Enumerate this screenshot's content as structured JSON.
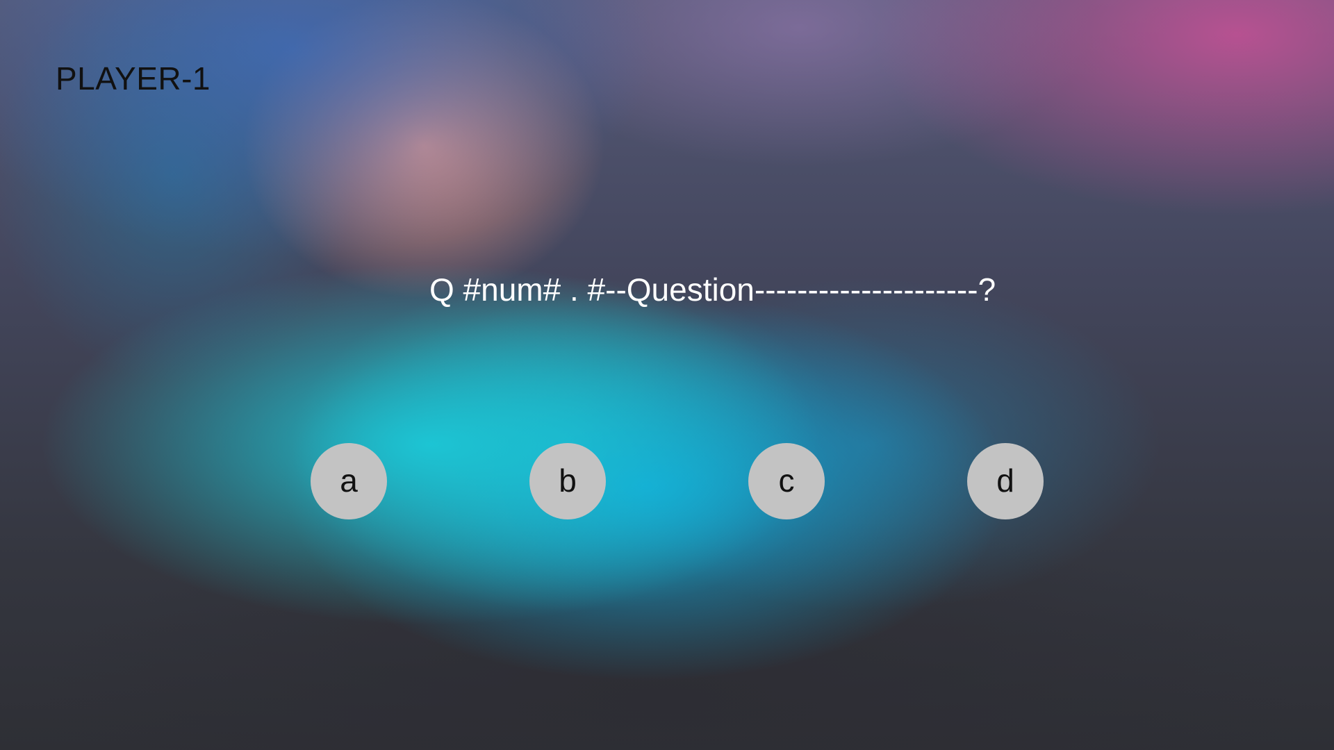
{
  "player": {
    "label": "PLAYER-1"
  },
  "question": {
    "text": "Q #num# . #--Question---------------------?"
  },
  "answers": [
    {
      "label": "a"
    },
    {
      "label": "b"
    },
    {
      "label": "c"
    },
    {
      "label": "d"
    }
  ],
  "colors": {
    "answer_button_bg": "#c3c3c3",
    "question_text": "#ffffff",
    "player_text": "#111111"
  }
}
